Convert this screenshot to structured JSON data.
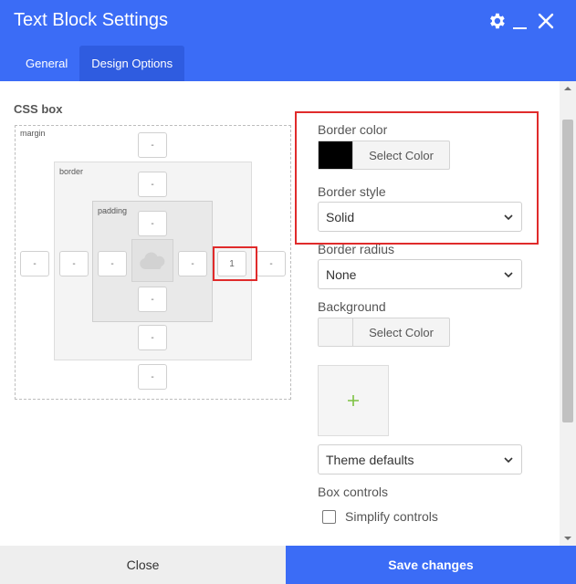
{
  "header": {
    "title": "Text Block Settings",
    "icons": [
      "gear-icon",
      "minimize-icon",
      "close-icon"
    ],
    "bg_color": "#3b6cf6"
  },
  "tabs": [
    {
      "label": "General",
      "active": false
    },
    {
      "label": "Design Options",
      "active": true
    }
  ],
  "css_box": {
    "label": "CSS box",
    "margin_label": "margin",
    "border_label": "border",
    "padding_label": "padding",
    "margin": {
      "top": "-",
      "right": "-",
      "bottom": "-",
      "left": "-"
    },
    "border": {
      "top": "-",
      "right": "1",
      "bottom": "-",
      "left": "-"
    },
    "padding": {
      "top": "-",
      "right": "-",
      "bottom": "-",
      "left": "-"
    },
    "content_icon": "cloud-icon"
  },
  "border_color": {
    "label": "Border color",
    "button_label": "Select Color",
    "swatch": "#000000"
  },
  "border_style": {
    "label": "Border style",
    "value": "Solid"
  },
  "border_radius": {
    "label": "Border radius",
    "value": "None"
  },
  "background": {
    "label": "Background",
    "button_label": "Select Color",
    "swatch": "#f4f4f4",
    "image_add_icon": "plus-icon",
    "image_option": "Theme defaults"
  },
  "box_controls": {
    "label": "Box controls",
    "checkbox_label": "Simplify controls",
    "checked": false
  },
  "footer": {
    "close_label": "Close",
    "save_label": "Save changes"
  },
  "highlight_color": "#e02b2b"
}
